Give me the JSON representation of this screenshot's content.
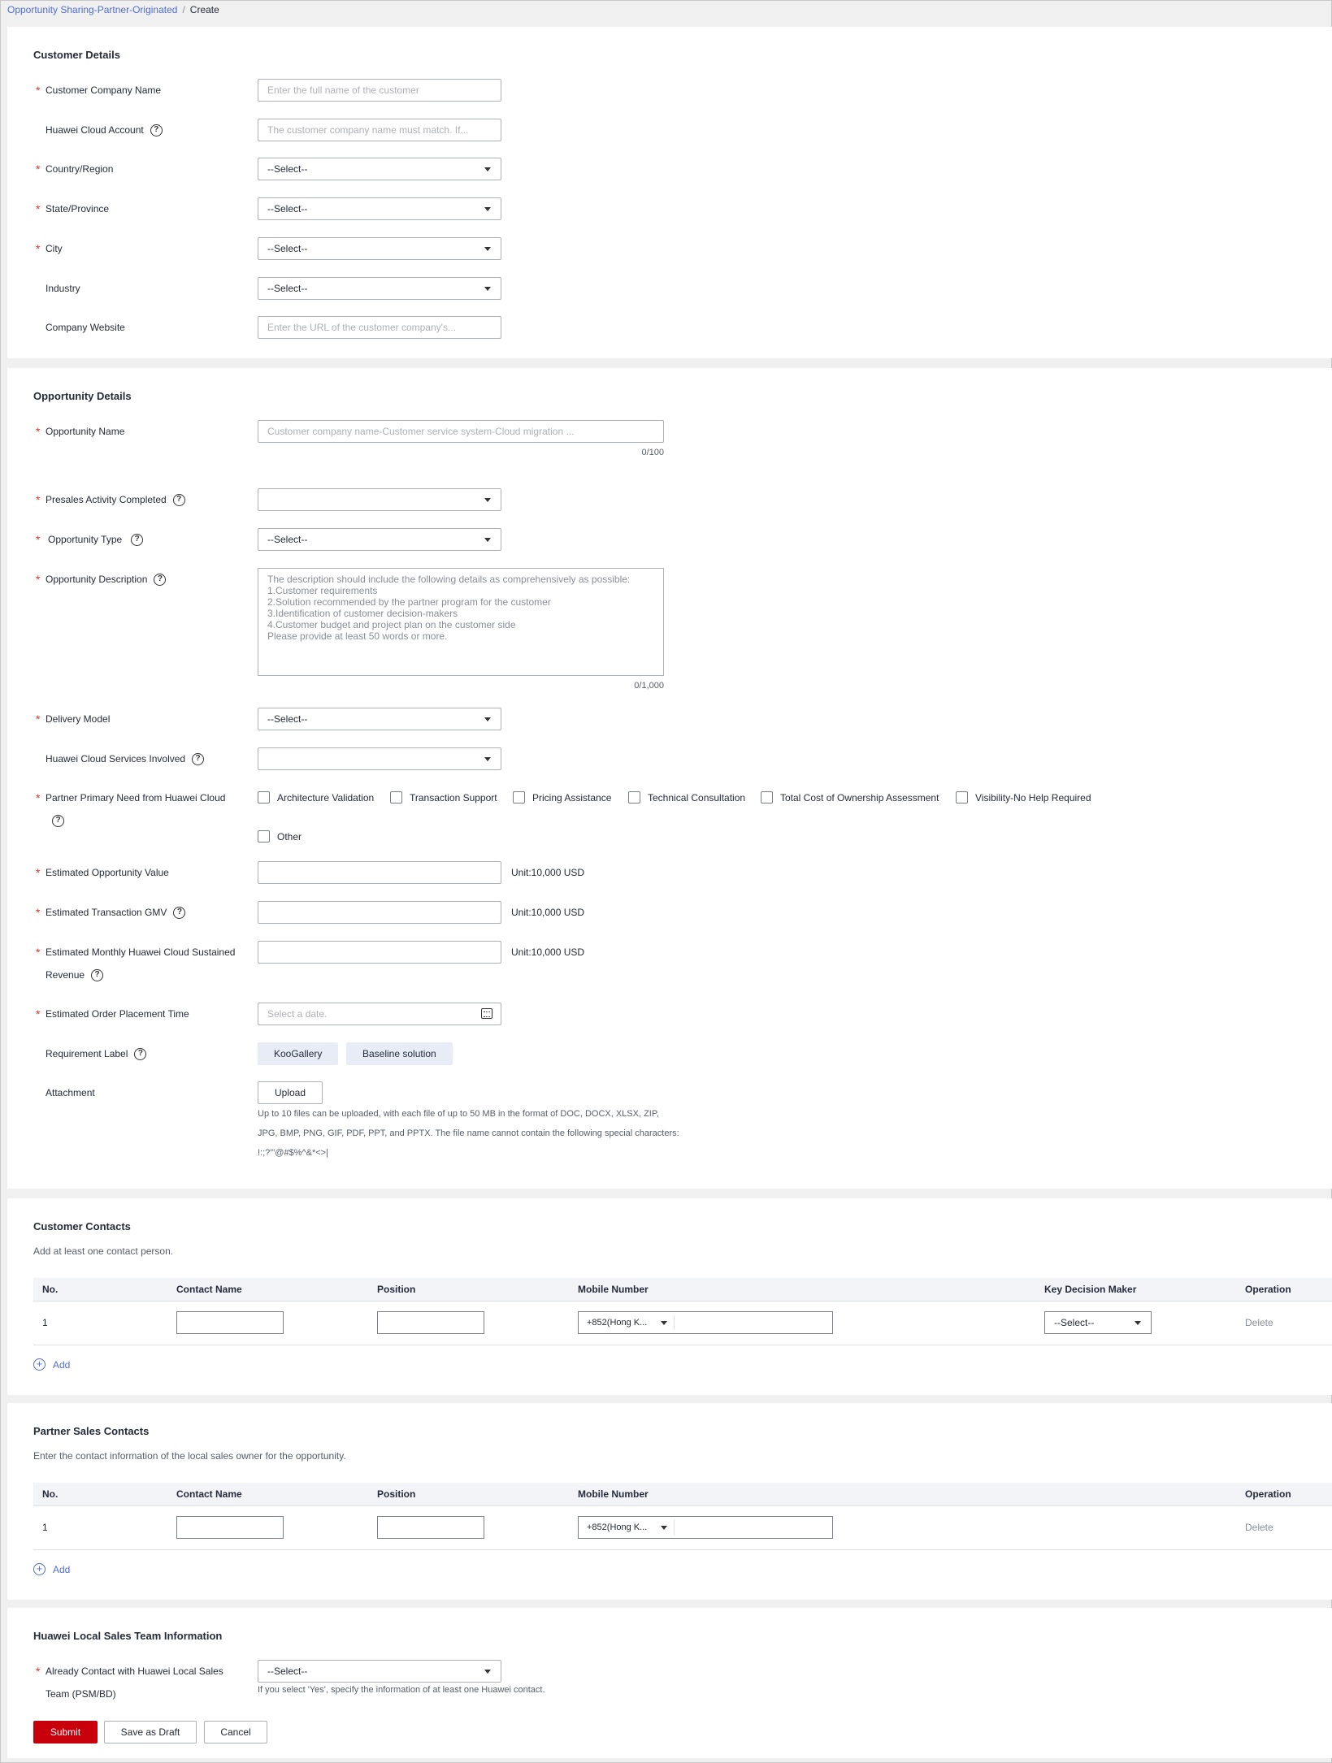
{
  "breadcrumb": {
    "parent": "Opportunity Sharing-Partner-Originated",
    "separator": "/",
    "current": "Create"
  },
  "customer": {
    "title": "Customer Details",
    "company_name": {
      "label": "Customer Company Name",
      "placeholder": "Enter the full name of the customer"
    },
    "cloud_account": {
      "label": "Huawei Cloud Account",
      "placeholder": "The customer company name must match. If..."
    },
    "country": {
      "label": "Country/Region",
      "value": "--Select--"
    },
    "state": {
      "label": "State/Province",
      "value": "--Select--"
    },
    "city": {
      "label": "City",
      "value": "--Select--"
    },
    "industry": {
      "label": "Industry",
      "value": "--Select--"
    },
    "website": {
      "label": "Company Website",
      "placeholder": "Enter the URL of the customer company's..."
    }
  },
  "opportunity": {
    "title": "Opportunity Details",
    "name": {
      "label": "Opportunity Name",
      "placeholder": "Customer company name-Customer service system-Cloud migration ...",
      "count": "0/100"
    },
    "presales": {
      "label": "Presales Activity Completed",
      "value": ""
    },
    "type": {
      "label": "Opportunity Type",
      "value": "--Select--"
    },
    "description": {
      "label": "Opportunity Description",
      "placeholder": "The description should include the following details as comprehensively as possible:\n1.Customer requirements\n2.Solution recommended by the partner program for the customer\n3.Identification of customer decision-makers\n4.Customer budget and project plan on the customer side\nPlease provide at least 50 words or more.",
      "count": "0/1,000"
    },
    "delivery": {
      "label": "Delivery Model",
      "value": "--Select--"
    },
    "services": {
      "label": "Huawei Cloud Services Involved",
      "value": ""
    },
    "needs": {
      "label": "Partner Primary Need from Huawei Cloud",
      "options": [
        "Architecture Validation",
        "Transaction Support",
        "Pricing Assistance",
        "Technical Consultation",
        "Total Cost of Ownership Assessment",
        "Visibility-No Help Required",
        "Other"
      ]
    },
    "est_value": {
      "label": "Estimated Opportunity Value",
      "unit": "Unit:10,000 USD"
    },
    "est_gmv": {
      "label": "Estimated Transaction GMV",
      "unit": "Unit:10,000 USD"
    },
    "est_monthly": {
      "label_line1": "Estimated Monthly Huawei Cloud Sustained",
      "label_line2": "Revenue",
      "unit": "Unit:10,000 USD"
    },
    "order_time": {
      "label": "Estimated Order Placement Time",
      "placeholder": "Select a date."
    },
    "req_label": {
      "label": "Requirement Label",
      "tags": [
        "KooGallery",
        "Baseline solution"
      ]
    },
    "attachment": {
      "label": "Attachment",
      "button": "Upload",
      "note": "Up to 10 files can be uploaded, with each file of up to 50 MB in the format of DOC, DOCX, XLSX, ZIP, JPG, BMP, PNG, GIF, PDF, PPT, and PPTX. The file name cannot contain the following special characters: !:;?\"'@#$%^&*<>|"
    }
  },
  "customer_contacts": {
    "title": "Customer Contacts",
    "desc": "Add at least one contact person.",
    "columns": [
      "No.",
      "Contact Name",
      "Position",
      "Mobile Number",
      "Key Decision Maker",
      "Operation"
    ],
    "row": {
      "no": "1",
      "phone_code": "+852(Hong K...",
      "decision": "--Select--",
      "op": "Delete"
    },
    "add": "Add"
  },
  "partner_contacts": {
    "title": "Partner Sales Contacts",
    "desc": "Enter the contact information of the local sales owner for the opportunity.",
    "columns": [
      "No.",
      "Contact Name",
      "Position",
      "Mobile Number",
      "Operation"
    ],
    "row": {
      "no": "1",
      "phone_code": "+852(Hong K...",
      "op": "Delete"
    },
    "add": "Add"
  },
  "local_team": {
    "title": "Huawei Local Sales Team Information",
    "contact": {
      "label_line1": "Already Contact with Huawei Local Sales",
      "label_line2": "Team (PSM/BD)",
      "value": "--Select--",
      "hint": "If you select 'Yes', specify the information of at least one Huawei contact."
    }
  },
  "actions": {
    "submit": "Submit",
    "draft": "Save as Draft",
    "cancel": "Cancel"
  },
  "colors": {
    "required": "#e3342f",
    "primary": "#c7000b",
    "link": "#526ecc"
  }
}
